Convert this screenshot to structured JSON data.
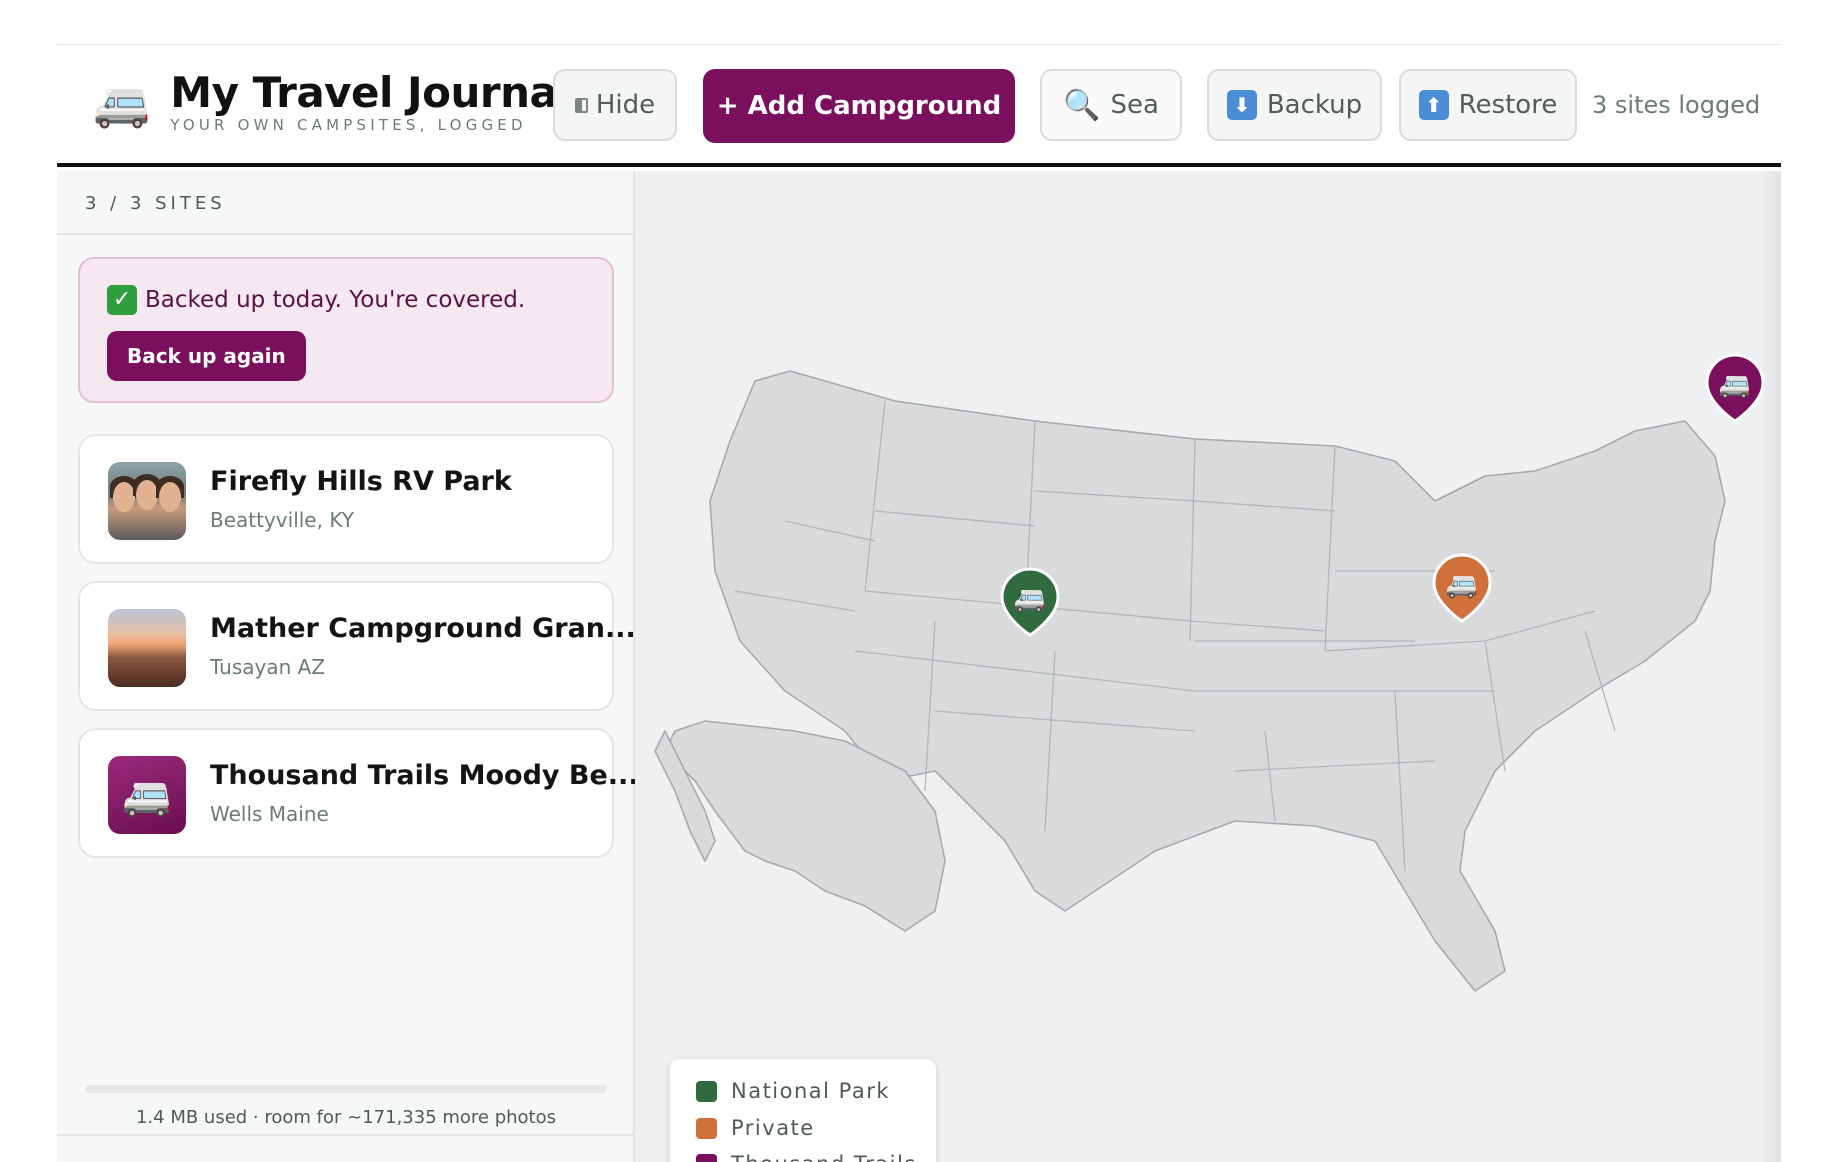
{
  "header": {
    "app_icon": "camper-van-icon",
    "title": "My Travel Journal",
    "subtitle": "YOUR OWN CAMPSITES, LOGGED",
    "hide_label": "Hide",
    "add_label": "+ Add Campground",
    "search_label": "Sea",
    "backup_label": "Backup",
    "restore_label": "Restore",
    "sites_logged": "3 sites logged"
  },
  "sidebar": {
    "count": "3 / 3 SITES",
    "backup_notice": {
      "message": "Backed up today. You're covered.",
      "button": "Back up again"
    },
    "sites": [
      {
        "name": "Firefly Hills RV Park",
        "location": "Beattyville, KY",
        "thumb": "people-photo"
      },
      {
        "name": "Mather Campground Gran...",
        "location": "Tusayan AZ",
        "thumb": "canyon-photo"
      },
      {
        "name": "Thousand Trails Moody Be...",
        "location": "Wells Maine",
        "thumb": "camper-van-icon"
      }
    ],
    "storage": "1.4 MB used · room for ~171,335 more photos"
  },
  "map": {
    "legend": [
      {
        "label": "National Park",
        "color": "#2f6b3f"
      },
      {
        "label": "Private",
        "color": "#d0703a"
      },
      {
        "label": "Thousand Trails",
        "color": "#7a0f5e"
      }
    ],
    "pins": [
      {
        "site": "Mather Campground Gran...",
        "category": "National Park",
        "color": "#2f6b3f"
      },
      {
        "site": "Firefly Hills RV Park",
        "category": "Private",
        "color": "#d0703a"
      },
      {
        "site": "Thousand Trails Moody Be...",
        "category": "Thousand Trails",
        "color": "#7a0f5e"
      }
    ]
  },
  "colors": {
    "brand": "#7a0f5e",
    "brand_tint": "#f6e8f0",
    "muted_text": "#6b7b7b"
  }
}
